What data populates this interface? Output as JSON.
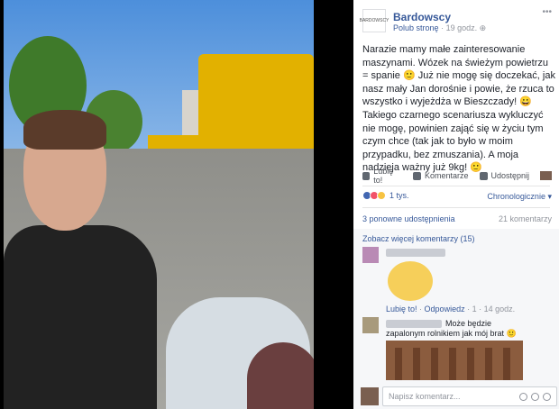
{
  "post": {
    "page_name": "Bardowscy",
    "avatar_label": "BARDOWSCY",
    "like_page": "Polub stronę",
    "time": "19 godz.",
    "text": "Narazie mamy małe zainteresowanie maszynami. Wózek na świeżym powietrzu = spanie 🙂 Już nie mogę się doczekać, jak nasz mały Jan dorośnie i powie, że rzuca to wszystko i wyjeżdża w Bieszczady! 😀 Takiego czarnego scenariusza wykluczyć nie mogę, powinien zająć się w życiu tym czym chce (tak jak to było w moim przypadku, bez zmuszania). A moja nadzieja ważny już 9kg! 🙂"
  },
  "actions": {
    "like": "Lubię to!",
    "comment": "Komentarze",
    "share": "Udostępnij"
  },
  "reactions": {
    "count": "1 tys.",
    "sort": "Chronologicznie"
  },
  "stats": {
    "shares": "3 ponowne udostępnienia",
    "comments": "21 komentarzy"
  },
  "comments": {
    "more": "Zobacz więcej komentarzy (15)",
    "first_meta": {
      "like": "Lubię to!",
      "reply": "Odpowiedz",
      "reactions": "1",
      "time": "14 godz."
    },
    "second_text": "Może będzie zapalonym rolnikiem jak mój brat 🙂"
  },
  "composer": {
    "placeholder": "Napisz komentarz..."
  }
}
